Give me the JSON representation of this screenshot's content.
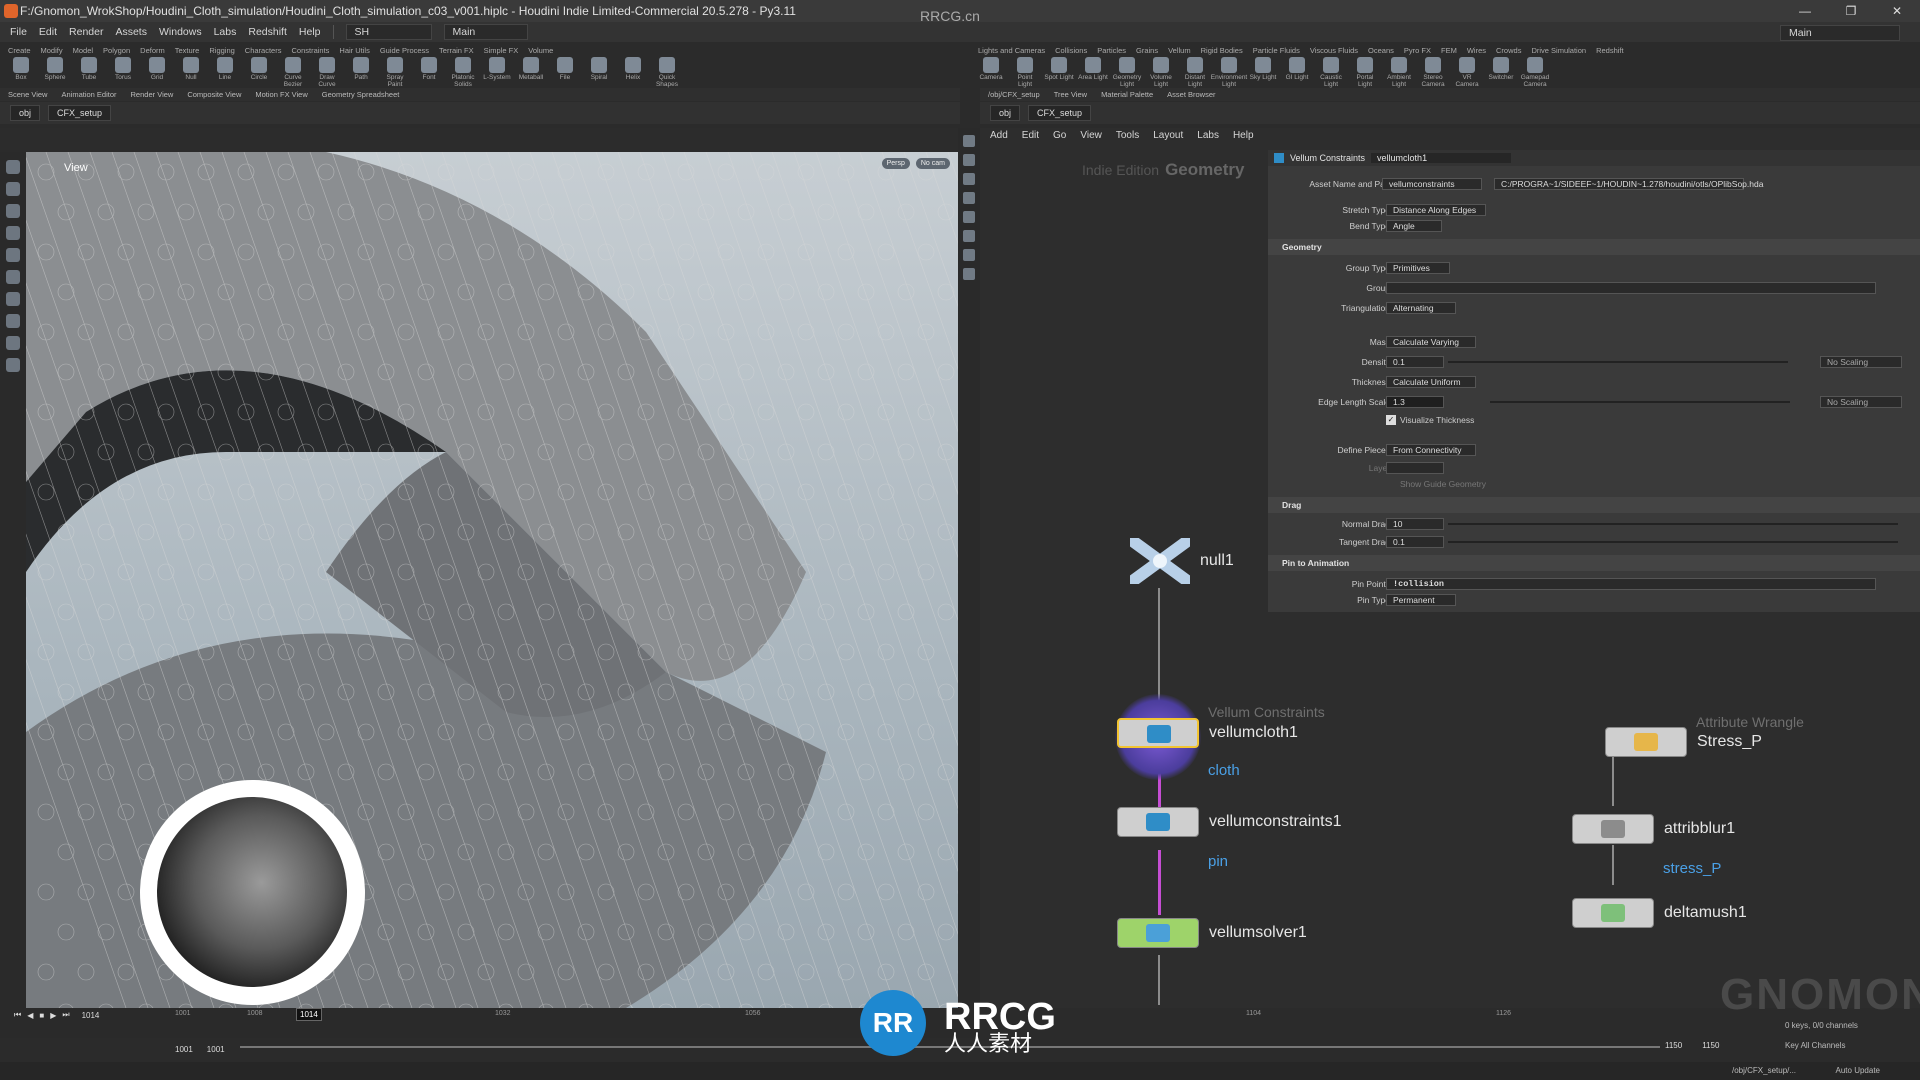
{
  "window": {
    "title": "F:/Gnomon_WrokShop/Houdini_Cloth_simulation/Houdini_Cloth_simulation_c03_v001.hiplc - Houdini Indie Limited-Commercial 20.5.278 - Py3.11",
    "controls": [
      "—",
      "❐",
      "✕"
    ]
  },
  "watermark_top": "RRCG.cn",
  "menubar": {
    "items": [
      "File",
      "Edit",
      "Render",
      "Assets",
      "Windows",
      "Labs",
      "Redshift",
      "Help"
    ],
    "desktop": "SH",
    "mode": "Main",
    "right_desktop": "Main"
  },
  "shelf_tabs_left": [
    "Create",
    "Modify",
    "Model",
    "Polygon",
    "Deform",
    "Texture",
    "Rigging",
    "Characters",
    "Constraints",
    "Hair Utils",
    "Guide Process",
    "Terrain FX",
    "Simple FX",
    "Volume"
  ],
  "shelf_tabs_right": [
    "Lights and Cameras",
    "Collisions",
    "Particles",
    "Grains",
    "Vellum",
    "Rigid Bodies",
    "Particle Fluids",
    "Viscous Fluids",
    "Oceans",
    "Pyro FX",
    "FEM",
    "Wires",
    "Crowds",
    "Drive Simulation",
    "Redshift"
  ],
  "shelf_tools_left": [
    "Box",
    "Sphere",
    "Tube",
    "Torus",
    "Grid",
    "Null",
    "Line",
    "Circle",
    "Curve Bezier",
    "Draw Curve",
    "Path",
    "Spray Paint",
    "Font",
    "Platonic Solids",
    "L-System",
    "Metaball",
    "File",
    "Spiral",
    "Helix",
    "Quick Shapes"
  ],
  "shelf_tools_right": [
    "Camera",
    "Point Light",
    "Spot Light",
    "Area Light",
    "Geometry Light",
    "Volume Light",
    "Distant Light",
    "Environment Light",
    "Sky Light",
    "GI Light",
    "Caustic Light",
    "Portal Light",
    "Ambient Light",
    "Stereo Camera",
    "VR Camera",
    "Switcher",
    "Gamepad Camera"
  ],
  "pane_tabs_left": [
    "Scene View",
    "Animation Editor",
    "Render View",
    "Composite View",
    "Motion FX View",
    "Geometry Spreadsheet"
  ],
  "pane_tabs_right": [
    "/obj/CFX_setup",
    "Tree View",
    "Material Palette",
    "Asset Browser"
  ],
  "path_left": {
    "root": "obj",
    "node": "CFX_setup"
  },
  "path_right": {
    "root": "obj",
    "node": "CFX_setup"
  },
  "viewport": {
    "label": "View",
    "camera": "Persp",
    "cam_menu": "No cam"
  },
  "net_menu": [
    "Add",
    "Edit",
    "Go",
    "View",
    "Tools",
    "Layout",
    "Labs",
    "Help"
  ],
  "net_watermark": {
    "edition": "Indie Edition",
    "context": "Geometry"
  },
  "parm": {
    "node_type": "Vellum Constraints",
    "node_name": "vellumcloth1",
    "asset_label": "Asset Name and Path",
    "asset_name": "vellumconstraints",
    "asset_path": "C:/PROGRA~1/SIDEEF~1/HOUDIN~1.278/houdini/otls/OPlibSop.hda",
    "stretch_type_label": "Stretch Type",
    "stretch_type": "Distance Along Edges",
    "bend_type_label": "Bend Type",
    "bend_type": "Angle",
    "geometry_section": "Geometry",
    "group_type_label": "Group Type",
    "group_type": "Primitives",
    "group_label": "Group",
    "triangulation_label": "Triangulation",
    "triangulation": "Alternating",
    "mass_label": "Mass",
    "mass": "Calculate Varying",
    "density_label": "Density",
    "density": "0.1",
    "density_scaling": "No Scaling",
    "thickness_label": "Thickness",
    "thickness": "Calculate Uniform",
    "edge_length_label": "Edge Length Scale",
    "edge_length": "1.3",
    "edge_scaling": "No Scaling",
    "visualize_label": "Visualize Thickness",
    "define_pieces_label": "Define Pieces",
    "define_pieces": "From Connectivity",
    "layer_label": "Layer",
    "show_guide_label": "Show Guide Geometry",
    "drag_section": "Drag",
    "normal_drag_label": "Normal Drag",
    "normal_drag": "10",
    "tangent_drag_label": "Tangent Drag",
    "tangent_drag": "0.1",
    "pin_section": "Pin to Animation",
    "pin_points_label": "Pin Points",
    "pin_points": "!collision",
    "pin_type_label": "Pin Type",
    "pin_type": "Permanent"
  },
  "nodes": {
    "null": {
      "name": "null1"
    },
    "cloth": {
      "type": "Vellum Constraints",
      "name": "vellumcloth1",
      "comment": "cloth"
    },
    "pin": {
      "name": "vellumconstraints1",
      "comment": "pin"
    },
    "solver": {
      "name": "vellumsolver1"
    },
    "wrangle": {
      "type": "Attribute Wrangle",
      "name": "Stress_P"
    },
    "blur": {
      "name": "attribblur1",
      "comment": "stress_P"
    },
    "mush": {
      "name": "deltamush1"
    }
  },
  "timeline": {
    "current_frame": "1014",
    "ticks": [
      "1001",
      "1008",
      "1014",
      "1032",
      "1056",
      "1104",
      "1126"
    ],
    "start": "1001",
    "start2": "1001",
    "end": "1150",
    "end2": "1150",
    "keys_info": "0 keys, 0/0 channels",
    "key_all": "Key All Channels",
    "auto_update": "Auto Update",
    "status_path": "/obj/CFX_setup/..."
  },
  "logo": {
    "mark": "RR",
    "text": "RRCG",
    "sub": "人人素材"
  },
  "brand_watermark": "GNOMON"
}
